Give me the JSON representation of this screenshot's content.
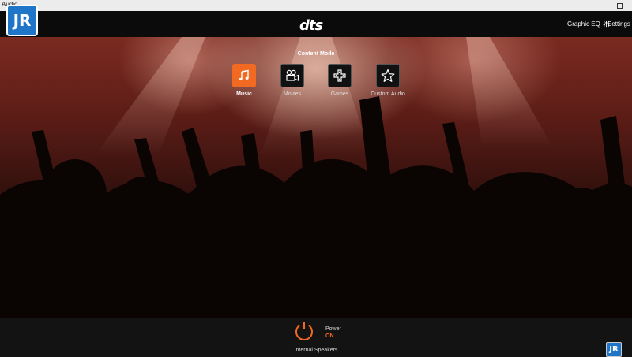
{
  "window": {
    "title": "Audio"
  },
  "header": {
    "logo": "dts",
    "graphic_eq_label": "Graphic EQ",
    "settings_label": "Settings"
  },
  "watermark": {
    "text": "JR"
  },
  "content_mode": {
    "title": "Content Mode",
    "modes": [
      {
        "label": "Music",
        "icon": "music-note-icon",
        "active": true
      },
      {
        "label": "Movies",
        "icon": "movie-camera-icon",
        "active": false
      },
      {
        "label": "Games",
        "icon": "gamepad-icon",
        "active": false
      },
      {
        "label": "Custom Audio",
        "icon": "star-icon",
        "active": false
      }
    ]
  },
  "footer": {
    "power_label": "Power",
    "power_state": "ON",
    "output_device": "Internal Speakers"
  },
  "colors": {
    "accent": "#f26a21",
    "header_bg": "#0b0b0b",
    "footer_bg": "#131313"
  }
}
